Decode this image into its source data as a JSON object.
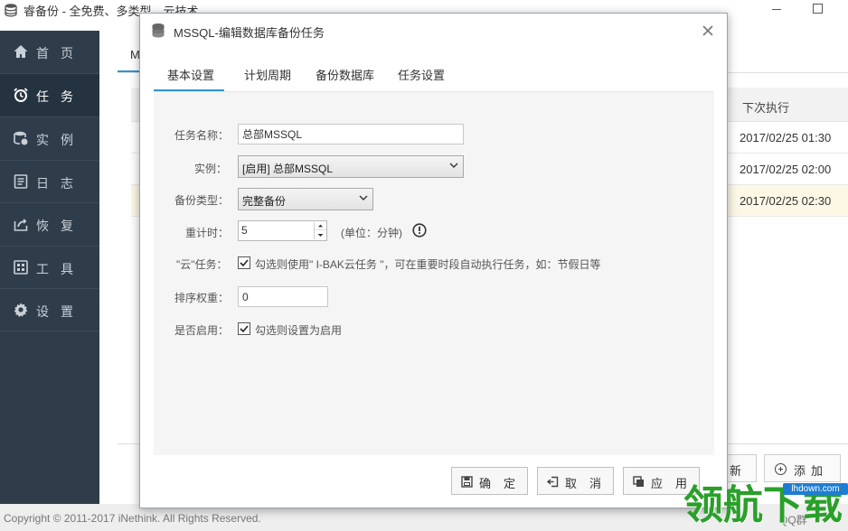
{
  "window": {
    "title": "睿备份 - 全免费、多类型、云技术"
  },
  "sidebar": {
    "items": [
      {
        "label": "首页",
        "icon": "home-icon"
      },
      {
        "label": "任务",
        "icon": "alarm-clock-icon",
        "active": true
      },
      {
        "label": "实例",
        "icon": "database-icon"
      },
      {
        "label": "日志",
        "icon": "log-icon"
      },
      {
        "label": "恢复",
        "icon": "restore-icon"
      },
      {
        "label": "工具",
        "icon": "tools-icon"
      },
      {
        "label": "设置",
        "icon": "gear-icon"
      }
    ]
  },
  "background": {
    "tab_label": "M",
    "table": {
      "next_run_header": "下次执行",
      "rows": [
        "2017/02/25 01:30",
        "2017/02/25 02:00",
        "2017/02/25 02:30"
      ]
    },
    "buttons": {
      "new_partial": "新",
      "add": "添加"
    },
    "copyright": "Copyright © 2011-2017 iNethink. All Rights Reserved.",
    "footer_right": "QQ群"
  },
  "dialog": {
    "title": "MSSQL-编辑数据库备份任务",
    "tabs": [
      "基本设置",
      "计划周期",
      "备份数据库",
      "任务设置"
    ],
    "form": {
      "task_name_label": "任务名称：",
      "task_name_value": "总部MSSQL",
      "instance_label": "实例：",
      "instance_value": "[启用] 总部MSSQL",
      "backup_type_label": "备份类型：",
      "backup_type_value": "完整备份",
      "retry_label": "重计时：",
      "retry_value": "5",
      "retry_unit": "(单位：分钟)",
      "cloud_label": "\"云\"任务：",
      "cloud_checkbox_label": "勾选则使用\" I-BAK云任务 \"，可在重要时段自动执行任务，如：节假日等",
      "cloud_checked": true,
      "sort_label": "排序权重：",
      "sort_value": "0",
      "enable_label": "是否启用：",
      "enable_checkbox_label": "勾选则设置为启用",
      "enable_checked": true
    },
    "buttons": {
      "ok": "确定",
      "cancel": "取消",
      "apply": "应用"
    }
  },
  "watermark": {
    "text": "领航下载",
    "url": "lhdown.com"
  },
  "colors": {
    "sidebar_bg": "#2f3d4b",
    "accent": "#2d95d3",
    "highlight_row": "#fdf8e6",
    "watermark_green": "#2aa02a"
  }
}
